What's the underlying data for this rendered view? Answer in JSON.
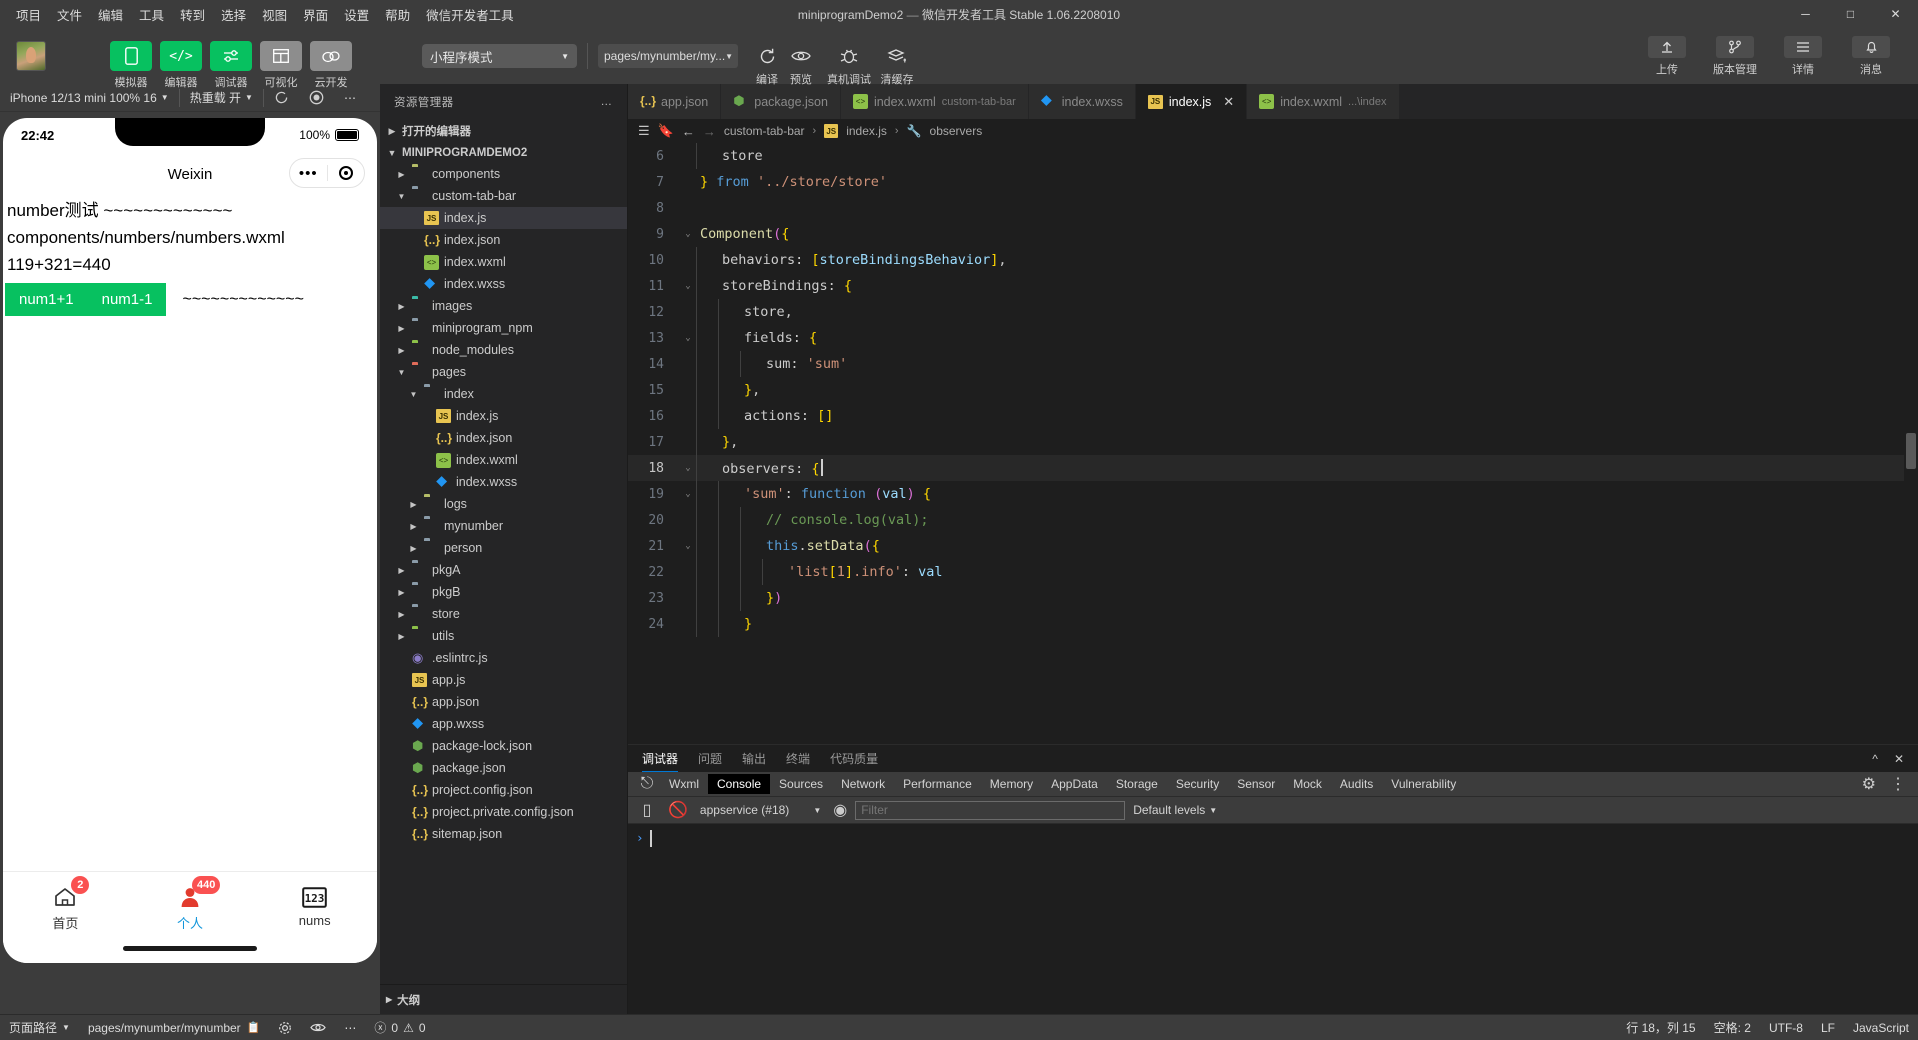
{
  "window": {
    "title": "miniprogramDemo2",
    "subtitle": "微信开发者工具 Stable 1.06.2208010",
    "minimize": "─",
    "maximize": "□",
    "close": "✕"
  },
  "menu": [
    "项目",
    "文件",
    "编辑",
    "工具",
    "转到",
    "选择",
    "视图",
    "界面",
    "设置",
    "帮助",
    "微信开发者工具"
  ],
  "toolbar": {
    "buttons": [
      {
        "label": "模拟器",
        "icon": "phone-icon",
        "color": "#07c160"
      },
      {
        "label": "编辑器",
        "icon": "code-icon",
        "color": "#07c160"
      },
      {
        "label": "调试器",
        "icon": "sliders-icon",
        "color": "#07c160"
      },
      {
        "label": "可视化",
        "icon": "layout-icon",
        "color": "#8d8d8d"
      },
      {
        "label": "云开发",
        "icon": "cloud-icon",
        "color": "#8d8d8d"
      }
    ],
    "mode": "小程序模式",
    "page": "pages/mynumber/my...",
    "actions": [
      {
        "label": "编译",
        "icon": "refresh-icon"
      },
      {
        "label": "预览",
        "icon": "eye-icon"
      },
      {
        "label": "真机调试",
        "icon": "bug-icon"
      },
      {
        "label": "清缓存",
        "icon": "stack-icon"
      }
    ],
    "right": [
      {
        "label": "上传",
        "icon": "upload-icon"
      },
      {
        "label": "版本管理",
        "icon": "branch-icon"
      },
      {
        "label": "详情",
        "icon": "list-icon"
      },
      {
        "label": "消息",
        "icon": "bell-icon"
      }
    ]
  },
  "simulator": {
    "device": "iPhone 12/13 mini 100% 16",
    "hotreload": "热重载 开",
    "refresh_icon": "refresh-icon",
    "record_icon": "record-icon",
    "more_icon": "more-icon",
    "phone": {
      "time": "22:42",
      "battery": "100%",
      "nav_title": "Weixin",
      "lines": [
        "number测试 ~~~~~~~~~~~~~",
        "components/numbers/numbers.wxml",
        "119+321=440"
      ],
      "buttons": [
        "num1+1",
        "num1-1"
      ],
      "tilde": "~~~~~~~~~~~~~",
      "tabs": [
        {
          "label": "首页",
          "icon": "home-icon",
          "badge": "2",
          "active": false
        },
        {
          "label": "个人",
          "icon": "person-icon",
          "badge": "440",
          "active": true
        },
        {
          "label": "nums",
          "icon": "numbers-icon",
          "badge": "",
          "active": false
        }
      ]
    }
  },
  "explorer": {
    "title": "资源管理器",
    "more": "…",
    "open_editors": "打开的编辑器",
    "project": "MINIPROGRAMDEMO2",
    "outline": "大纲",
    "tree": [
      {
        "name": "components",
        "indent": 1,
        "type": "folder-yellow",
        "tw": "▶"
      },
      {
        "name": "custom-tab-bar",
        "indent": 1,
        "type": "folder-plain",
        "tw": "▼"
      },
      {
        "name": "index.js",
        "indent": 2,
        "type": "js",
        "tw": "",
        "selected": true
      },
      {
        "name": "index.json",
        "indent": 2,
        "type": "json",
        "tw": ""
      },
      {
        "name": "index.wxml",
        "indent": 2,
        "type": "wxml",
        "tw": ""
      },
      {
        "name": "index.wxss",
        "indent": 2,
        "type": "wxss",
        "tw": ""
      },
      {
        "name": "images",
        "indent": 1,
        "type": "folder-teal",
        "tw": "▶"
      },
      {
        "name": "miniprogram_npm",
        "indent": 1,
        "type": "folder-blue",
        "tw": "▶"
      },
      {
        "name": "node_modules",
        "indent": 1,
        "type": "folder-green",
        "tw": "▶"
      },
      {
        "name": "pages",
        "indent": 1,
        "type": "folder-red",
        "tw": "▼"
      },
      {
        "name": "index",
        "indent": 2,
        "type": "folder-plain",
        "tw": "▼"
      },
      {
        "name": "index.js",
        "indent": 3,
        "type": "js",
        "tw": ""
      },
      {
        "name": "index.json",
        "indent": 3,
        "type": "json",
        "tw": ""
      },
      {
        "name": "index.wxml",
        "indent": 3,
        "type": "wxml",
        "tw": ""
      },
      {
        "name": "index.wxss",
        "indent": 3,
        "type": "wxss",
        "tw": ""
      },
      {
        "name": "logs",
        "indent": 2,
        "type": "folder-yellow",
        "tw": "▶"
      },
      {
        "name": "mynumber",
        "indent": 2,
        "type": "folder-blue",
        "tw": "▶"
      },
      {
        "name": "person",
        "indent": 2,
        "type": "folder-blue",
        "tw": "▶"
      },
      {
        "name": "pkgA",
        "indent": 1,
        "type": "folder-blue",
        "tw": "▶"
      },
      {
        "name": "pkgB",
        "indent": 1,
        "type": "folder-blue",
        "tw": "▶"
      },
      {
        "name": "store",
        "indent": 1,
        "type": "folder-blue",
        "tw": "▶"
      },
      {
        "name": "utils",
        "indent": 1,
        "type": "folder-green",
        "tw": "▶"
      },
      {
        "name": ".eslintrc.js",
        "indent": 1,
        "type": "eslint",
        "tw": ""
      },
      {
        "name": "app.js",
        "indent": 1,
        "type": "js",
        "tw": ""
      },
      {
        "name": "app.json",
        "indent": 1,
        "type": "json",
        "tw": ""
      },
      {
        "name": "app.wxss",
        "indent": 1,
        "type": "wxss",
        "tw": ""
      },
      {
        "name": "package-lock.json",
        "indent": 1,
        "type": "node",
        "tw": ""
      },
      {
        "name": "package.json",
        "indent": 1,
        "type": "node",
        "tw": ""
      },
      {
        "name": "project.config.json",
        "indent": 1,
        "type": "json",
        "tw": ""
      },
      {
        "name": "project.private.config.json",
        "indent": 1,
        "type": "json",
        "tw": ""
      },
      {
        "name": "sitemap.json",
        "indent": 1,
        "type": "json",
        "tw": ""
      }
    ]
  },
  "editor": {
    "tabs": [
      {
        "label": "app.json",
        "sub": "",
        "type": "json",
        "active": false,
        "closable": false
      },
      {
        "label": "package.json",
        "sub": "",
        "type": "node",
        "active": false,
        "closable": false
      },
      {
        "label": "index.wxml",
        "sub": "custom-tab-bar",
        "type": "wxml",
        "active": false,
        "closable": false
      },
      {
        "label": "index.wxss",
        "sub": "",
        "type": "wxss",
        "active": false,
        "closable": false
      },
      {
        "label": "index.js",
        "sub": "",
        "type": "js",
        "active": true,
        "closable": true
      },
      {
        "label": "index.wxml",
        "sub": "...\\index",
        "type": "wxml",
        "active": false,
        "closable": false
      }
    ],
    "close_glyph": "✕",
    "breadcrumb": [
      "custom-tab-bar",
      "index.js",
      "observers"
    ],
    "breadcrumb_sep": "›",
    "lines": [
      {
        "n": 6,
        "fold": "",
        "cur": false,
        "indent": 1,
        "html": "store"
      },
      {
        "n": 7,
        "fold": "",
        "cur": false,
        "indent": 0,
        "html": "} from '../store/store'"
      },
      {
        "n": 8,
        "fold": "",
        "cur": false,
        "indent": 0,
        "html": ""
      },
      {
        "n": 9,
        "fold": "v",
        "cur": false,
        "indent": 0,
        "html": "Component({"
      },
      {
        "n": 10,
        "fold": "",
        "cur": false,
        "indent": 1,
        "html": "behaviors: [storeBindingsBehavior],"
      },
      {
        "n": 11,
        "fold": "v",
        "cur": false,
        "indent": 1,
        "html": "storeBindings: {"
      },
      {
        "n": 12,
        "fold": "",
        "cur": false,
        "indent": 2,
        "html": "store,"
      },
      {
        "n": 13,
        "fold": "v",
        "cur": false,
        "indent": 2,
        "html": "fields: {"
      },
      {
        "n": 14,
        "fold": "",
        "cur": false,
        "indent": 3,
        "html": "sum: 'sum'"
      },
      {
        "n": 15,
        "fold": "",
        "cur": false,
        "indent": 2,
        "html": "},"
      },
      {
        "n": 16,
        "fold": "",
        "cur": false,
        "indent": 2,
        "html": "actions: []"
      },
      {
        "n": 17,
        "fold": "",
        "cur": false,
        "indent": 1,
        "html": "},"
      },
      {
        "n": 18,
        "fold": "v",
        "cur": true,
        "indent": 1,
        "html": "observers: {"
      },
      {
        "n": 19,
        "fold": "v",
        "cur": false,
        "indent": 2,
        "html": "'sum': function (val) {"
      },
      {
        "n": 20,
        "fold": "",
        "cur": false,
        "indent": 3,
        "html": "// console.log(val);"
      },
      {
        "n": 21,
        "fold": "v",
        "cur": false,
        "indent": 3,
        "html": "this.setData({"
      },
      {
        "n": 22,
        "fold": "",
        "cur": false,
        "indent": 4,
        "html": "'list[1].info': val"
      },
      {
        "n": 23,
        "fold": "",
        "cur": false,
        "indent": 3,
        "html": "})"
      },
      {
        "n": 24,
        "fold": "",
        "cur": false,
        "indent": 2,
        "html": "}"
      }
    ]
  },
  "debugger": {
    "panels": [
      "调试器",
      "问题",
      "输出",
      "终端",
      "代码质量"
    ],
    "active_panel": "调试器",
    "collapse_icon": "chevron-up-icon",
    "close_icon": "close-icon",
    "devtools_tabs": [
      "Wxml",
      "Console",
      "Sources",
      "Network",
      "Performance",
      "Memory",
      "AppData",
      "Storage",
      "Security",
      "Sensor",
      "Mock",
      "Audits",
      "Vulnerability"
    ],
    "active_devtools_tab": "Console",
    "inspect_icon": "inspect-icon",
    "settings_icon": "gear-icon",
    "more_icon": "kebab-icon",
    "console": {
      "context": "appservice (#18)",
      "filter_placeholder": "Filter",
      "levels": "Default levels",
      "prompt": "›",
      "clear_icon": "no-entry-icon",
      "sidebar_icon": "panel-icon",
      "eye_icon": "eye-icon"
    }
  },
  "statusbar": {
    "page_path_label": "页面路径",
    "page_path": "pages/mynumber/mynumber",
    "copy_icon": "copy-icon",
    "settings_icon": "gear-icon",
    "eye_icon": "eye-icon",
    "more_icon": "more-icon",
    "errors": "0",
    "warnings": "0",
    "error_icon": "ⓧ",
    "warn_icon": "⚠",
    "position": "行 18，列 15",
    "spaces": "空格: 2",
    "encoding": "UTF-8",
    "eol": "LF",
    "language": "JavaScript"
  }
}
